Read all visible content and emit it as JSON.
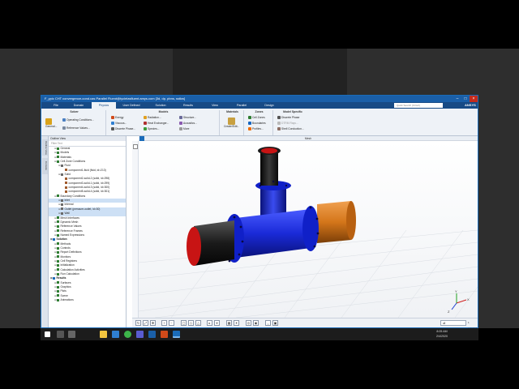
{
  "window": {
    "title": "F_ypic CHT convergence-cond.cas Parallel Fluent@tyclelasfluent.amys.com [3d, dp, pbns, sstkw]"
  },
  "menu": {
    "tabs": [
      "File",
      "Domain",
      "Physics",
      "User Defined",
      "Solution",
      "Results",
      "View",
      "Parallel",
      "Design"
    ],
    "active": "Physics",
    "search_placeholder": "Quick Search (Ctrl+F)",
    "brand": "ANSYS"
  },
  "ribbon": {
    "groups": [
      {
        "title": "Solver",
        "items": [
          "General...",
          "Operating Conditions...",
          "Reference Values..."
        ]
      },
      {
        "title": "Models",
        "items": [
          "Energy",
          "Viscous...",
          "Radiation...",
          "Heat Exchanger...",
          "Species...",
          "Discrete Phase...",
          "Structure...",
          "Acoustics...",
          "More"
        ]
      },
      {
        "title": "Materials",
        "items": [
          "Create/Edit..."
        ]
      },
      {
        "title": "Zones",
        "items": [
          "Cell Zones",
          "Boundaries",
          "Profiles..."
        ]
      },
      {
        "title": "Model Specific",
        "items": [
          "Discrete Phase",
          "DTRM Rays...",
          "Shell Conduction..."
        ]
      }
    ]
  },
  "side_tabs": [
    "Outline View",
    "Console"
  ],
  "outline": {
    "header": "Outline View",
    "filter_placeholder": "Filter Text",
    "items": [
      {
        "label": "General",
        "level": 1
      },
      {
        "label": "Models",
        "level": 1
      },
      {
        "label": "Materials",
        "level": 1
      },
      {
        "label": "Cell Zone Conditions",
        "level": 1
      },
      {
        "label": "Fluid",
        "level": 2
      },
      {
        "label": "component1-fluid (fluid, id=213)",
        "level": 3
      },
      {
        "label": "Solid",
        "level": 2
      },
      {
        "label": "component2-solid-2 (solid, id=298)",
        "level": 3
      },
      {
        "label": "component3-solid-1 (solid, id=299)",
        "level": 3
      },
      {
        "label": "component4-solid-3 (solid, id=300)",
        "level": 3
      },
      {
        "label": "component5-solid-4 (solid, id=301)",
        "level": 3
      },
      {
        "label": "Boundary Conditions",
        "level": 1
      },
      {
        "label": "Inlet",
        "level": 2,
        "selected": true
      },
      {
        "label": "Internal",
        "level": 2
      },
      {
        "label": "Outlet (pressure-outlet, id=30)",
        "level": 2,
        "selected": true
      },
      {
        "label": "Wall",
        "level": 2,
        "selected": true
      },
      {
        "label": "Mesh Interfaces",
        "level": 1
      },
      {
        "label": "Dynamic Mesh",
        "level": 1
      },
      {
        "label": "Reference Values",
        "level": 1
      },
      {
        "label": "Reference Frames",
        "level": 1
      },
      {
        "label": "Named Expressions",
        "level": 1
      },
      {
        "label": "Solution",
        "level": 0
      },
      {
        "label": "Methods",
        "level": 1
      },
      {
        "label": "Controls",
        "level": 1
      },
      {
        "label": "Report Definitions",
        "level": 1
      },
      {
        "label": "Monitors",
        "level": 1
      },
      {
        "label": "Cell Registers",
        "level": 1
      },
      {
        "label": "Initialization",
        "level": 1
      },
      {
        "label": "Calculation Activities",
        "level": 1
      },
      {
        "label": "Run Calculation",
        "level": 1
      },
      {
        "label": "Results",
        "level": 0
      },
      {
        "label": "Surfaces",
        "level": 1
      },
      {
        "label": "Graphics",
        "level": 1
      },
      {
        "label": "Plots",
        "level": 1
      },
      {
        "label": "Scene",
        "level": 1
      },
      {
        "label": "Animations",
        "level": 1
      }
    ]
  },
  "viewport": {
    "title": "Mesh",
    "colors": {
      "inlet": "#c81414",
      "flange": "#1020c8",
      "outlet": "#d4761a",
      "dark": "#1a1a1a",
      "axis_x": "#d02020",
      "axis_y": "#20a020",
      "axis_z": "#2040d0"
    },
    "axes": {
      "x": "X",
      "y": "Y",
      "z": "Z"
    }
  },
  "bottombar": {
    "select_value": "all",
    "status": "1 selected"
  },
  "taskbar": {
    "time": "8:05 AM",
    "date": "2/4/2020"
  }
}
